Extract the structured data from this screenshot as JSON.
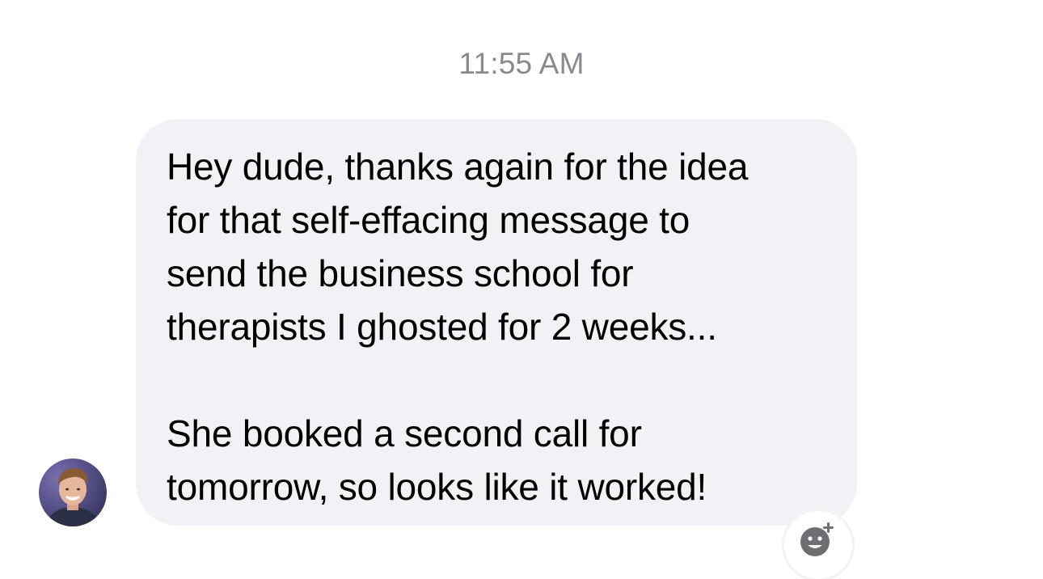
{
  "conversation": {
    "timestamp": "11:55 AM",
    "message": {
      "lines": [
        "Hey dude, thanks again for the idea",
        "for that self-effacing message to",
        "send the business school for",
        "therapists I ghosted for 2 weeks...",
        "",
        "She booked a second call for",
        "tomorrow, so looks like it worked!"
      ]
    },
    "sender": {
      "avatar_icon": "person-avatar"
    },
    "reaction": {
      "icon": "add-reaction-icon"
    }
  },
  "colors": {
    "bubble": "#f1f2f6",
    "timestamp": "#8a8a8e",
    "reaction_icon": "#6e6e73"
  }
}
